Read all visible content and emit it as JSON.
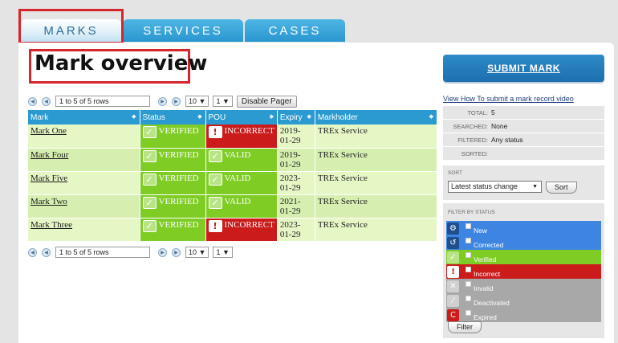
{
  "tabs": [
    {
      "label": "MARKS"
    },
    {
      "label": "SERVICES"
    },
    {
      "label": "CASES"
    }
  ],
  "page_title": "Mark overview",
  "pager": {
    "top_info": "1 to 5 of 5 rows",
    "bottom_info": "1 to 5 of 5 rows",
    "page_size": "10",
    "page_number": "1",
    "disable_label": "Disable Pager"
  },
  "table": {
    "headers": [
      "Mark",
      "Status",
      "POU",
      "Expiry",
      "Markholder"
    ],
    "rows": [
      {
        "mark": "Mark One",
        "status": "VERIFIED",
        "pou": "INCORRECT",
        "expiry": "2019-01-29",
        "markholder": "TREx Service"
      },
      {
        "mark": "Mark Four",
        "status": "VERIFIED",
        "pou": "VALID",
        "expiry": "2019-01-29",
        "markholder": "TREx Service"
      },
      {
        "mark": "Mark Five",
        "status": "VERIFIED",
        "pou": "VALID",
        "expiry": "2023-01-29",
        "markholder": "TREx Service"
      },
      {
        "mark": "Mark Two",
        "status": "VERIFIED",
        "pou": "VALID",
        "expiry": "2021-01-29",
        "markholder": "TREx Service"
      },
      {
        "mark": "Mark Three",
        "status": "VERIFIED",
        "pou": "INCORRECT",
        "expiry": "2023-01-29",
        "markholder": "TREx Service"
      }
    ]
  },
  "sidebar": {
    "submit_label": "SUBMIT MARK",
    "video_link": "View How To submit a mark record video",
    "stats": [
      {
        "key": "TOTAL:",
        "value": "5"
      },
      {
        "key": "SEARCHED:",
        "value": "None"
      },
      {
        "key": "FILTERED:",
        "value": "Any status"
      },
      {
        "key": "SORTED:",
        "value": ""
      }
    ],
    "sort": {
      "label": "SORT",
      "selected": "Latest status change",
      "button": "Sort"
    },
    "filter": {
      "label": "FILTER BY STATUS",
      "items": [
        {
          "label": "New",
          "color": "#3d85e0",
          "icon": "gear-icon"
        },
        {
          "label": "Corrected",
          "color": "#3d85e0",
          "icon": "undo-icon"
        },
        {
          "label": "Verified",
          "color": "#7fcc25",
          "icon": "check-icon"
        },
        {
          "label": "Incorrect",
          "color": "#cc1b1b",
          "icon": "warning-icon"
        },
        {
          "label": "Invalid",
          "color": "#a8a8a8",
          "icon": "x-icon"
        },
        {
          "label": "Deactivated",
          "color": "#a8a8a8",
          "icon": "slash-icon"
        },
        {
          "label": "Expired",
          "color": "#a8a8a8",
          "icon": "expired-icon"
        }
      ],
      "button": "Filter"
    }
  }
}
